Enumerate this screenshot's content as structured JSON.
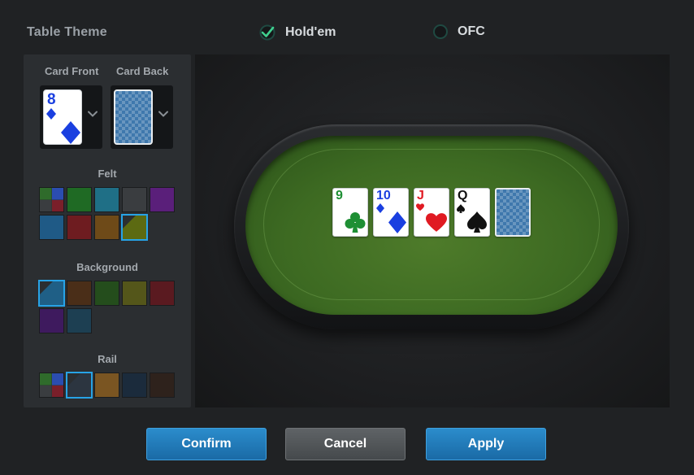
{
  "header": {
    "title": "Table Theme",
    "modes": [
      {
        "label": "Hold'em",
        "selected": true
      },
      {
        "label": "OFC",
        "selected": false
      }
    ]
  },
  "accent_color": "#27a3e6",
  "cards": {
    "front_label": "Card Front",
    "back_label": "Card Back",
    "front_preview": {
      "rank": "8",
      "suit": "diamond",
      "color": "#1a3fe0"
    }
  },
  "felt": {
    "title": "Felt",
    "swatches": [
      {
        "color": "multi",
        "selected": false
      },
      {
        "color": "#1f6a24",
        "selected": false
      },
      {
        "color": "#1f6f86",
        "selected": false
      },
      {
        "color": "#3a3d40",
        "selected": false
      },
      {
        "color": "#5a1f7a",
        "selected": false
      },
      {
        "color": "#1f5a86",
        "selected": false
      },
      {
        "color": "#6e1c20",
        "selected": false
      },
      {
        "color": "#6e4a18",
        "selected": false
      },
      {
        "color": "#5c6a12",
        "selected": true
      }
    ]
  },
  "background": {
    "title": "Background",
    "swatches": [
      {
        "color": "#1f5f86",
        "selected": true
      },
      {
        "color": "#4a2e18",
        "selected": false
      },
      {
        "color": "#244d1c",
        "selected": false
      },
      {
        "color": "#54561a",
        "selected": false
      },
      {
        "color": "#5a1a20",
        "selected": false
      },
      {
        "color": "#3e1a5e",
        "selected": false
      },
      {
        "color": "#1d3f52",
        "selected": false
      }
    ]
  },
  "rail": {
    "title": "Rail",
    "swatches": [
      {
        "color": "multi",
        "selected": false
      },
      {
        "color": "#2c3540",
        "selected": true
      },
      {
        "color": "#7a5522",
        "selected": false
      },
      {
        "color": "#1b2b3c",
        "selected": false
      },
      {
        "color": "#2e221c",
        "selected": false
      }
    ]
  },
  "board": [
    {
      "rank": "9",
      "suit": "club",
      "color": "#1e8f34"
    },
    {
      "rank": "10",
      "suit": "diamond",
      "color": "#1a3fe0"
    },
    {
      "rank": "J",
      "suit": "heart",
      "color": "#e01a22"
    },
    {
      "rank": "Q",
      "suit": "spade",
      "color": "#111111"
    },
    {
      "rank": "",
      "suit": "back",
      "color": ""
    }
  ],
  "buttons": {
    "confirm": "Confirm",
    "cancel": "Cancel",
    "apply": "Apply"
  }
}
